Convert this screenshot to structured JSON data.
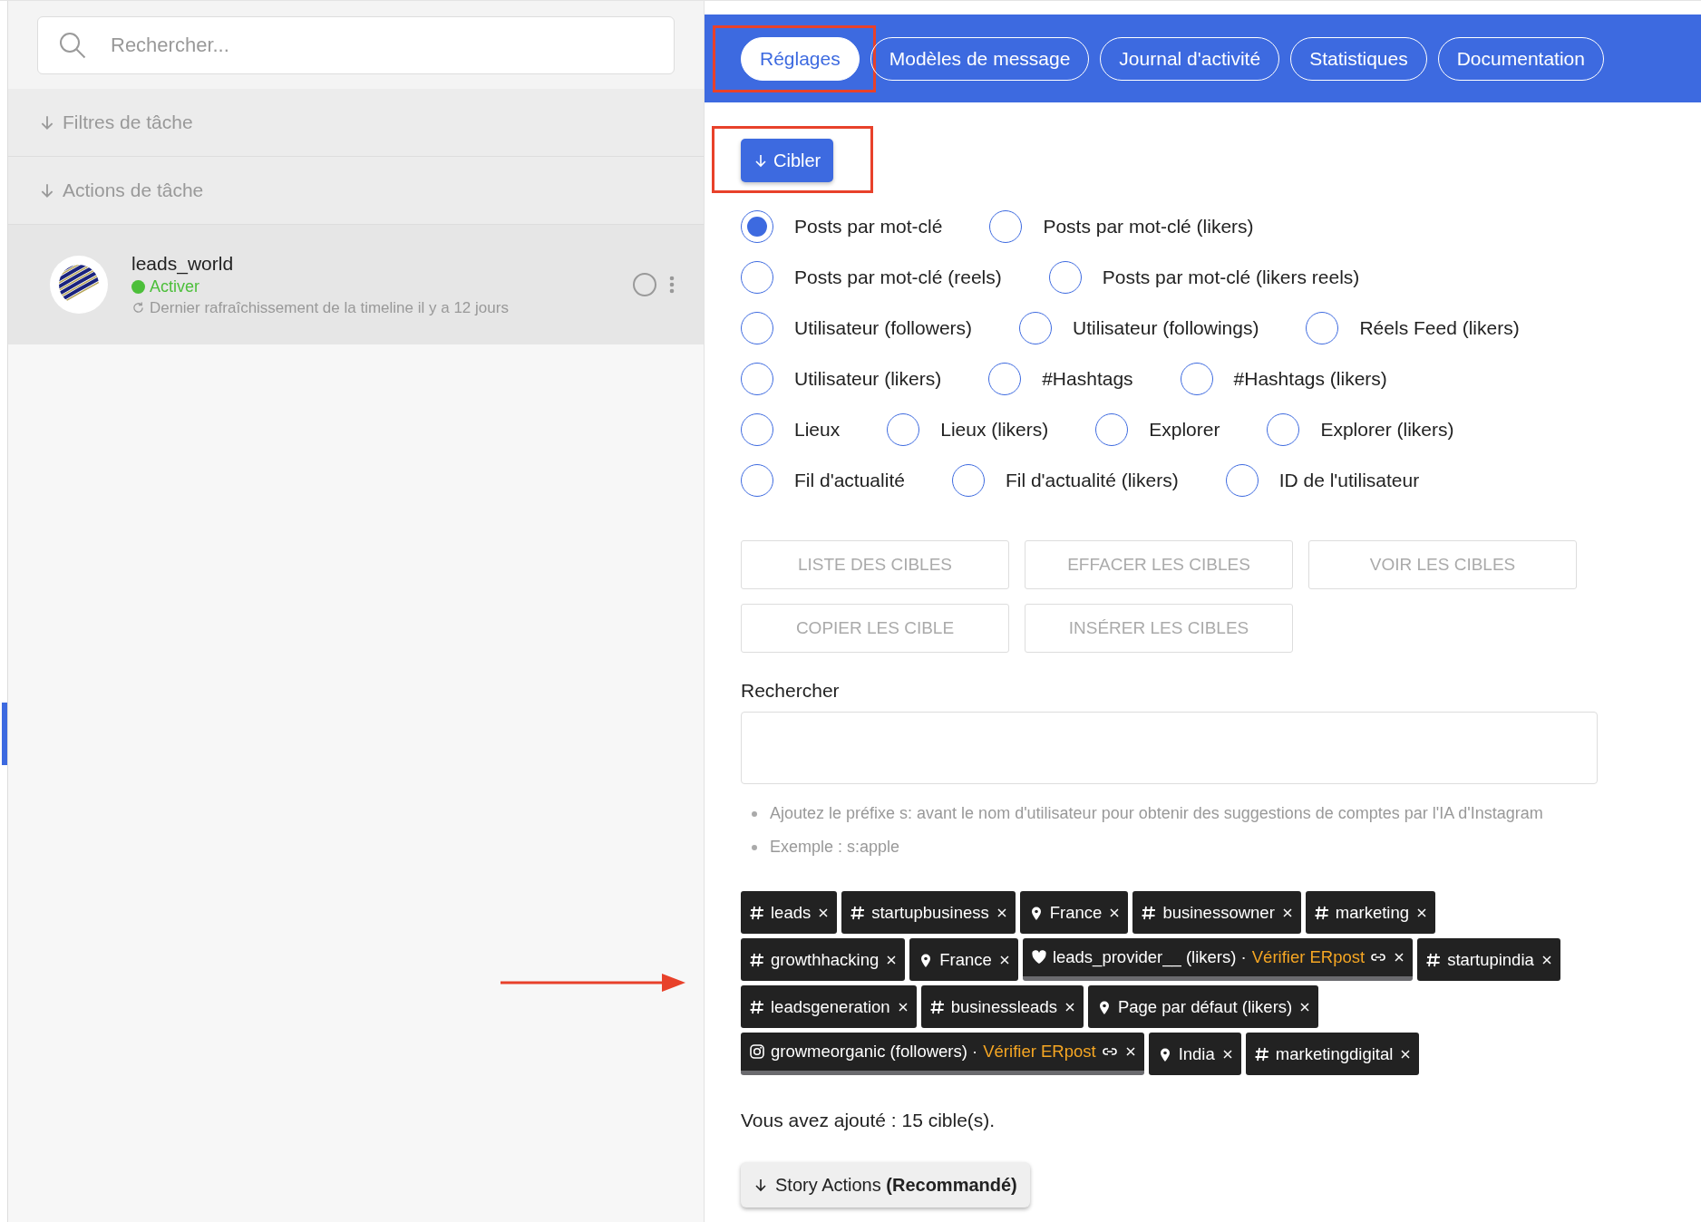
{
  "sidebar": {
    "search": {
      "placeholder": "Rechercher..."
    },
    "sections": [
      {
        "label": "Filtres de tâche",
        "expanded": false
      },
      {
        "label": "Actions de tâche",
        "expanded": false
      }
    ],
    "accounts": [
      {
        "name": "leads_world",
        "status": "Activer",
        "active": true,
        "refresh": "Dernier rafraîchissement de la timeline il y a 12 jours",
        "selected": true
      }
    ]
  },
  "tabs": [
    {
      "label": "Réglages",
      "selected": true,
      "highlighted": true
    },
    {
      "label": "Modèles de message",
      "selected": false,
      "highlighted": false
    },
    {
      "label": "Journal d'activité",
      "selected": false,
      "highlighted": false
    },
    {
      "label": "Statistiques",
      "selected": false,
      "highlighted": false
    },
    {
      "label": "Documentation",
      "selected": false,
      "highlighted": false
    }
  ],
  "section_button": {
    "label": "Cibler",
    "highlighted": true
  },
  "target_rows": [
    [
      {
        "label": "Posts par mot-clé",
        "selected": true
      },
      {
        "label": "Posts par mot-clé (likers)",
        "selected": false
      }
    ],
    [
      {
        "label": "Posts par mot-clé (reels)",
        "selected": false
      },
      {
        "label": "Posts par mot-clé (likers reels)",
        "selected": false
      }
    ],
    [
      {
        "label": "Utilisateur (followers)",
        "selected": false
      },
      {
        "label": "Utilisateur (followings)",
        "selected": false
      },
      {
        "label": "Réels Feed (likers)",
        "selected": false
      }
    ],
    [
      {
        "label": "Utilisateur (likers)",
        "selected": false
      },
      {
        "label": "#Hashtags",
        "selected": false
      },
      {
        "label": "#Hashtags (likers)",
        "selected": false
      }
    ],
    [
      {
        "label": "Lieux",
        "selected": false
      },
      {
        "label": "Lieux (likers)",
        "selected": false
      },
      {
        "label": "Explorer",
        "selected": false
      },
      {
        "label": "Explorer (likers)",
        "selected": false
      }
    ],
    [
      {
        "label": "Fil d'actualité",
        "selected": false
      },
      {
        "label": "Fil d'actualité (likers)",
        "selected": false
      },
      {
        "label": "ID de l'utilisateur",
        "selected": false
      }
    ]
  ],
  "action_rows": [
    [
      "LISTE DES CIBLES",
      "EFFACER LES CIBLES",
      "VOIR LES CIBLES"
    ],
    [
      "COPIER LES CIBLE",
      "INSÉRER LES CIBLES"
    ]
  ],
  "search": {
    "label": "Rechercher"
  },
  "hints": [
    "Ajoutez le préfixe s: avant le nom d'utilisateur pour obtenir des suggestions de comptes par l'IA d'Instagram",
    "Exemple : s:apple"
  ],
  "tag_rows": [
    [
      {
        "kind": "hashtag",
        "label": "leads"
      },
      {
        "kind": "hashtag",
        "label": "startupbusiness"
      },
      {
        "kind": "location",
        "label": "France"
      },
      {
        "kind": "hashtag",
        "label": "businessowner"
      },
      {
        "kind": "hashtag",
        "label": "marketing"
      }
    ],
    [
      {
        "kind": "hashtag",
        "label": "growthhacking"
      },
      {
        "kind": "location",
        "label": "France"
      },
      {
        "kind": "likers",
        "label": "leads_provider__ (likers) ·",
        "link": "Vérifier ERpost"
      },
      {
        "kind": "hashtag",
        "label": "startupindia"
      }
    ],
    [
      {
        "kind": "hashtag",
        "label": "leadsgeneration"
      },
      {
        "kind": "hashtag",
        "label": "businessleads"
      },
      {
        "kind": "location",
        "label": "Page par défaut (likers)"
      }
    ],
    [
      {
        "kind": "account",
        "label": "growmeorganic (followers) ·",
        "link": "Vérifier ERpost"
      },
      {
        "kind": "location",
        "label": "India"
      },
      {
        "kind": "hashtag",
        "label": "marketingdigital"
      }
    ]
  ],
  "summary": "Vous avez ajouté : 15 cible(s).",
  "story_button": {
    "label": "Story Actions **(Recommandé)**"
  },
  "annotations": [
    {
      "kind": "arrow"
    }
  ]
}
